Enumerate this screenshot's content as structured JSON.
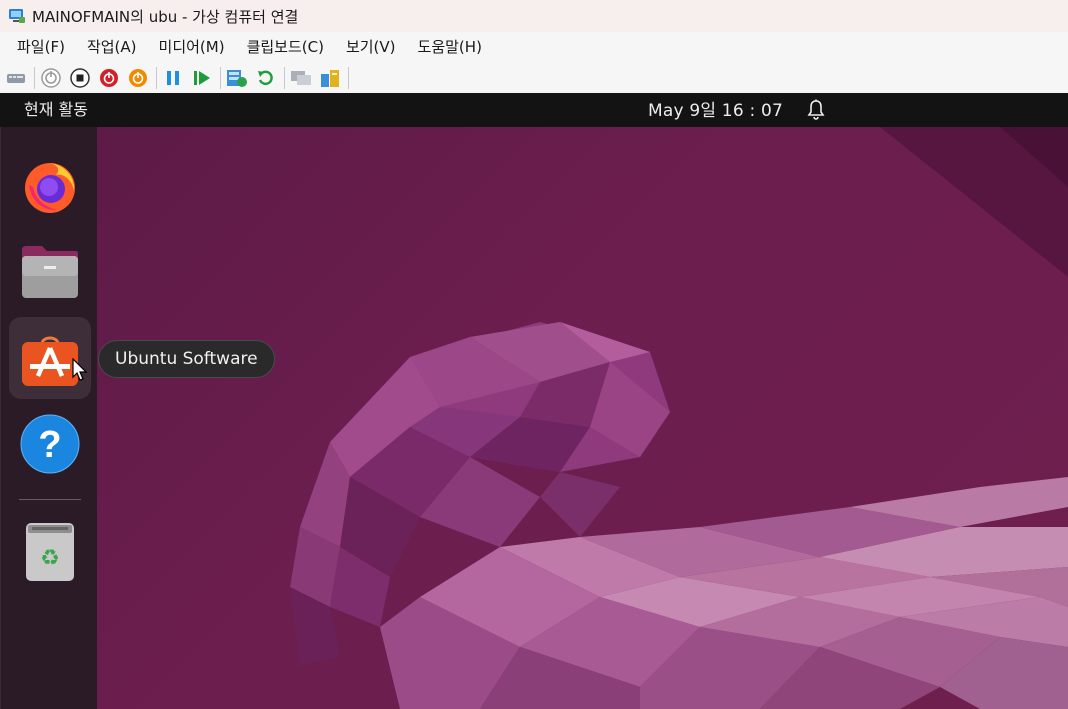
{
  "window": {
    "title": "MAINOFMAIN의 ubu - 가상 컴퓨터 연결",
    "app_icon": "hyperv-vm-icon"
  },
  "menubar": {
    "items": [
      {
        "label": "파일(F)"
      },
      {
        "label": "작업(A)"
      },
      {
        "label": "미디어(M)"
      },
      {
        "label": "클립보드(C)"
      },
      {
        "label": "보기(V)"
      },
      {
        "label": "도움말(H)"
      }
    ]
  },
  "toolbar": {
    "buttons": [
      {
        "name": "ctrl-alt-del-icon"
      },
      {
        "name": "start-icon"
      },
      {
        "name": "turn-off-icon"
      },
      {
        "name": "shutdown-icon"
      },
      {
        "name": "power-icon"
      },
      {
        "name": "pause-icon"
      },
      {
        "name": "resume-icon"
      },
      {
        "name": "checkpoint-icon"
      },
      {
        "name": "revert-icon"
      },
      {
        "name": "enhanced-session-icon"
      },
      {
        "name": "share-icon"
      }
    ]
  },
  "ubuntu": {
    "activities_label": "현재 활동",
    "clock": "May 9일  16 : 07",
    "dock": {
      "items": [
        {
          "name": "firefox-icon"
        },
        {
          "name": "files-icon"
        },
        {
          "name": "ubuntu-software-icon",
          "active": true
        },
        {
          "name": "help-icon"
        },
        {
          "name": "trash-icon"
        }
      ]
    },
    "tooltip": "Ubuntu Software"
  },
  "colors": {
    "wallpaper": "#6c1e4f",
    "topbar": "#131313",
    "dock": "#2b1b26",
    "software_orange": "#e95420"
  }
}
